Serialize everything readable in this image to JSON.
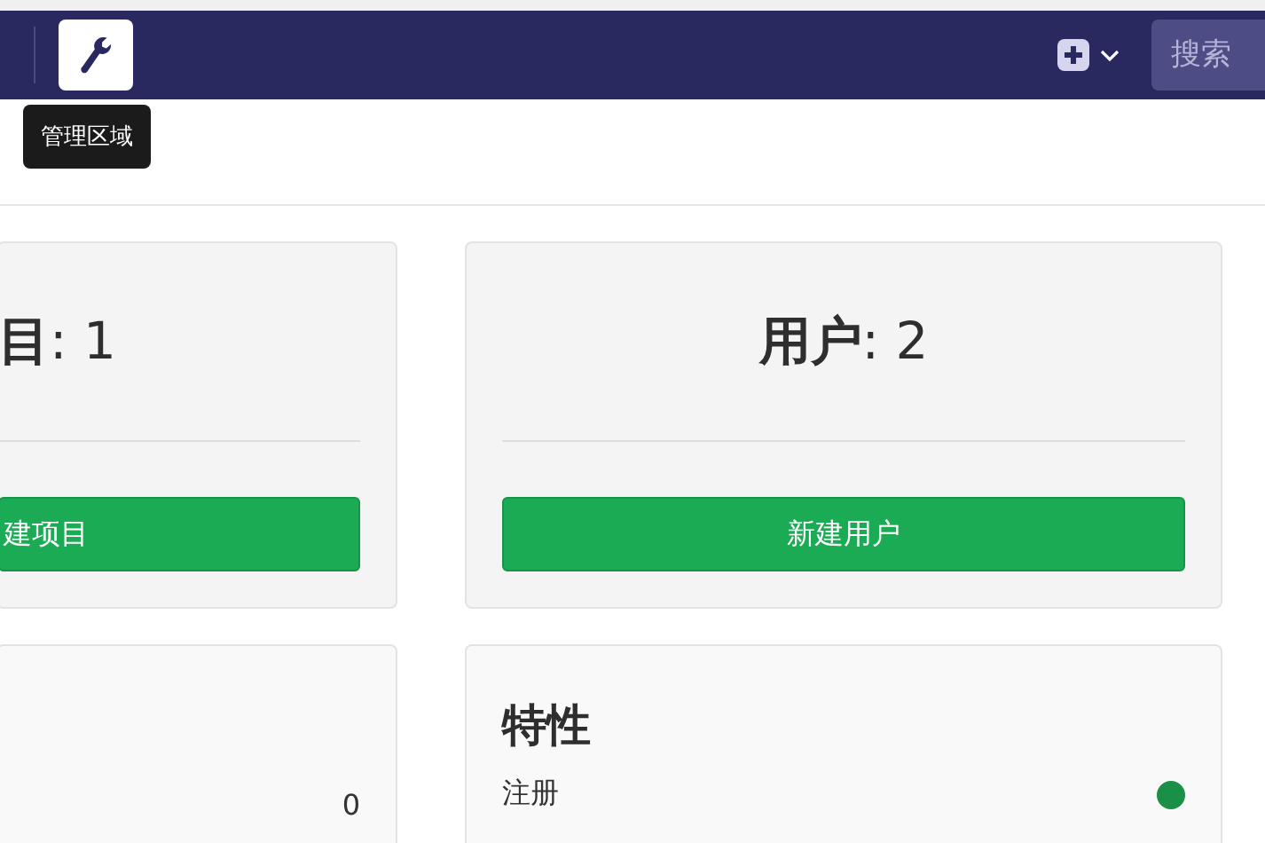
{
  "navbar": {
    "admin_button": {
      "tooltip": "管理区域"
    },
    "search": {
      "placeholder": "搜索"
    }
  },
  "stat_cards": [
    {
      "title": "**目**: 1",
      "button": "建项目"
    },
    {
      "title": "**用户**: 2",
      "button": "新建用户"
    }
  ],
  "lower_cards": [
    {
      "value": "0"
    },
    {
      "title": "特性",
      "features": [
        {
          "label": "注册",
          "enabled": true
        }
      ]
    }
  ]
}
